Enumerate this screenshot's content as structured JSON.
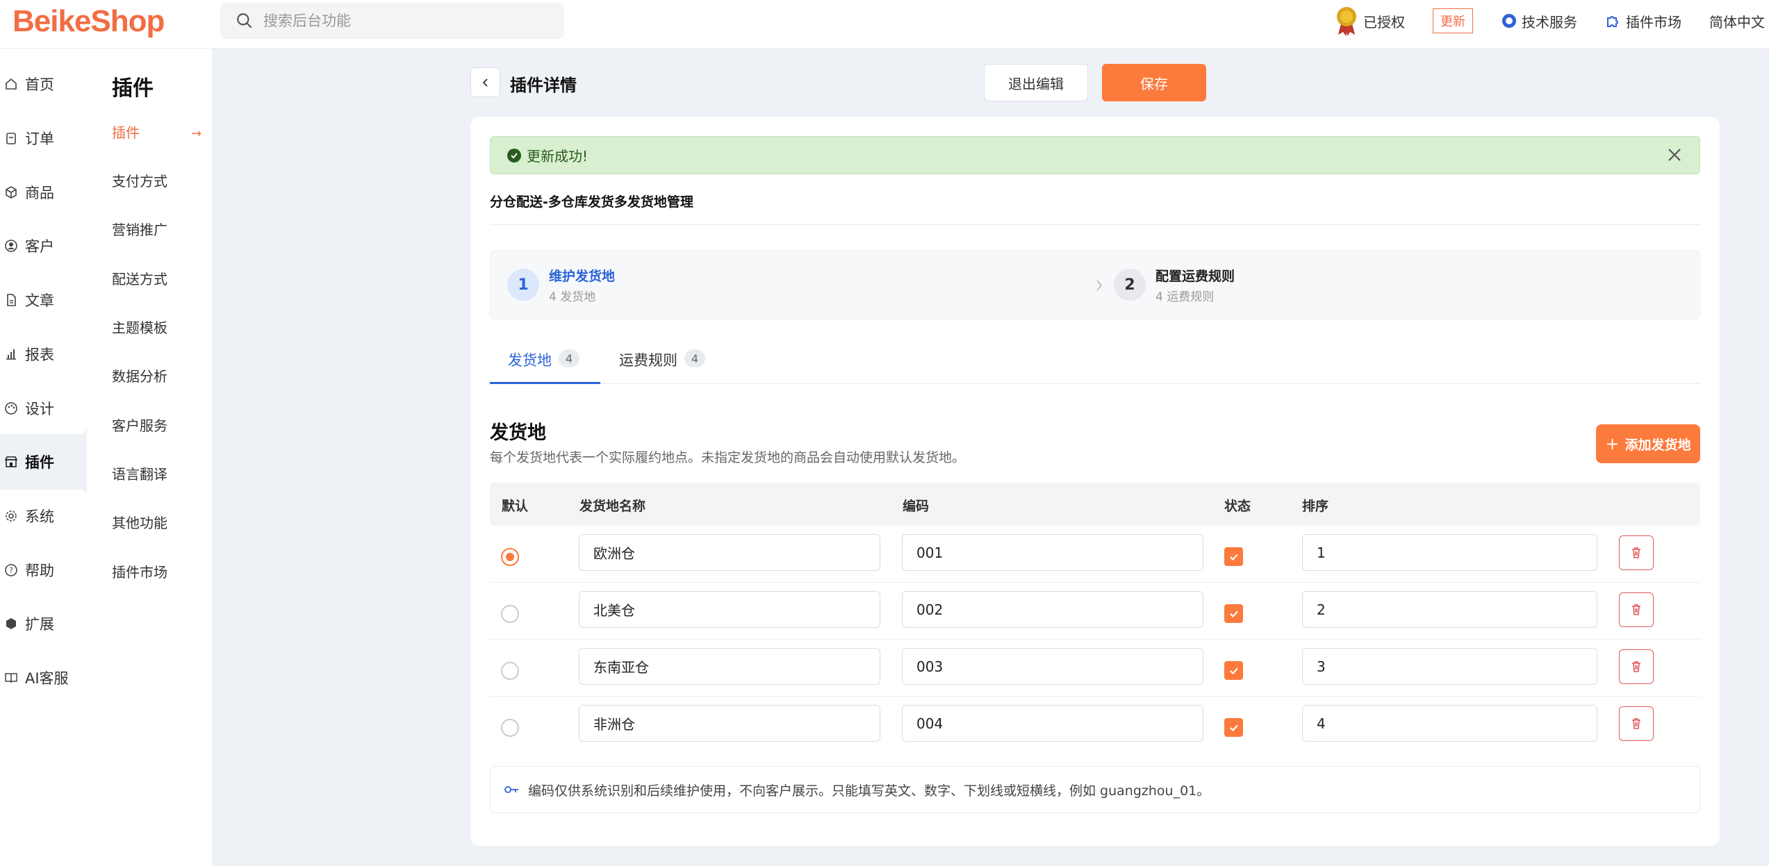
{
  "header": {
    "logo": "BeikeShop",
    "search_placeholder": "搜索后台功能",
    "authorized": "已授权",
    "update": "更新",
    "tech_service": "技术服务",
    "plugin_market": "插件市场",
    "language": "简体中文"
  },
  "sidebar": {
    "items": [
      {
        "label": "首页",
        "icon": "home-icon"
      },
      {
        "label": "订单",
        "icon": "order-icon"
      },
      {
        "label": "商品",
        "icon": "box-icon"
      },
      {
        "label": "客户",
        "icon": "user-icon"
      },
      {
        "label": "文章",
        "icon": "document-icon"
      },
      {
        "label": "报表",
        "icon": "chart-icon"
      },
      {
        "label": "设计",
        "icon": "palette-icon"
      },
      {
        "label": "插件",
        "icon": "store-icon"
      },
      {
        "label": "系统",
        "icon": "gear-icon"
      },
      {
        "label": "帮助",
        "icon": "help-icon"
      },
      {
        "label": "扩展",
        "icon": "cube-icon"
      },
      {
        "label": "AI客服",
        "icon": "book-icon"
      }
    ],
    "active": "插件"
  },
  "submenu": {
    "title": "插件",
    "items": [
      "插件",
      "支付方式",
      "营销推广",
      "配送方式",
      "主题模板",
      "数据分析",
      "客户服务",
      "语言翻译",
      "其他功能",
      "插件市场"
    ]
  },
  "page": {
    "title": "插件详情",
    "exit_label": "退出编辑",
    "save_label": "保存"
  },
  "alert": {
    "message": "更新成功!"
  },
  "plugin_name": "分仓配送-多仓库发货多发货地管理",
  "steps": [
    {
      "num": "1",
      "title": "维护发货地",
      "sub": "4 发货地"
    },
    {
      "num": "2",
      "title": "配置运费规则",
      "sub": "4 运费规则"
    }
  ],
  "tabs": [
    {
      "label": "发货地",
      "count": "4"
    },
    {
      "label": "运费规则",
      "count": "4"
    }
  ],
  "section": {
    "title": "发货地",
    "desc": "每个发货地代表一个实际履约地点。未指定发货地的商品会自动使用默认发货地。",
    "add_label": "添加发货地"
  },
  "table": {
    "headers": {
      "default": "默认",
      "name": "发货地名称",
      "code": "编码",
      "status": "状态",
      "sort": "排序"
    },
    "rows": [
      {
        "name": "欧洲仓",
        "code": "001",
        "sort": "1",
        "default": true,
        "enabled": true
      },
      {
        "name": "北美仓",
        "code": "002",
        "sort": "2",
        "default": false,
        "enabled": true
      },
      {
        "name": "东南亚仓",
        "code": "003",
        "sort": "3",
        "default": false,
        "enabled": true
      },
      {
        "name": "非洲仓",
        "code": "004",
        "sort": "4",
        "default": false,
        "enabled": true
      }
    ]
  },
  "hint": "编码仅供系统识别和后续维护使用，不向客户展示。只能填写英文、数字、下划线或短横线，例如 guangzhou_01。",
  "colors": {
    "accent": "#fc7a3c",
    "primary": "#2b63d9",
    "success_bg": "#d8efd0"
  }
}
